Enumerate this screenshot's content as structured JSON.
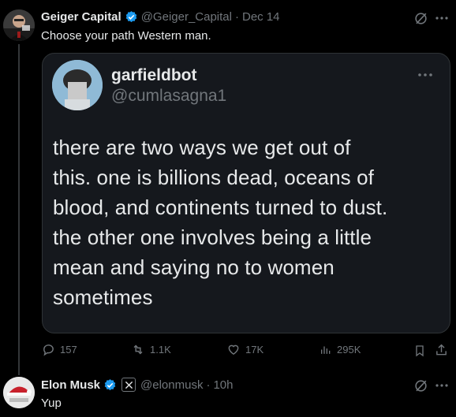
{
  "tweet1": {
    "display_name": "Geiger Capital",
    "handle": "@Geiger_Capital",
    "sep": "·",
    "date": "Dec 14",
    "text": "Choose your path Western man.",
    "actions": {
      "replies": "157",
      "retweets": "1.1K",
      "likes": "17K",
      "views": "295K"
    }
  },
  "quoted": {
    "display_name": "garfieldbot",
    "handle": "@cumlasagna1",
    "lines": [
      "there are two ways we get out of",
      "this. one is billions dead, oceans of",
      "blood, and continents turned to dust.",
      "the other one involves being a little",
      "mean and saying no to women",
      "sometimes"
    ]
  },
  "tweet2": {
    "display_name": "Elon Musk",
    "handle": "@elonmusk",
    "sep": "·",
    "date": "10h",
    "text": "Yup"
  },
  "icons": {
    "verified": "verified-badge-icon",
    "grok": "grok-icon",
    "more": "more-icon",
    "reply": "reply-icon",
    "retweet": "retweet-icon",
    "like": "heart-icon",
    "views": "views-icon",
    "bookmark": "bookmark-icon",
    "share": "share-icon",
    "affiliate": "x-affiliate-badge-icon"
  },
  "colors": {
    "background": "#000000",
    "verified_blue": "#1d9bf0",
    "muted": "#71767b",
    "text": "#e7e9ea",
    "thread_line": "#333639"
  }
}
